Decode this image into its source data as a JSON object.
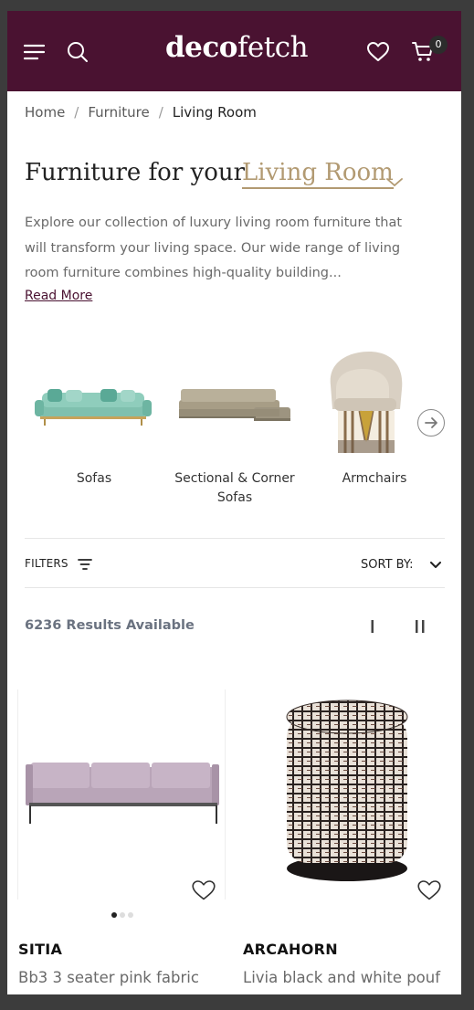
{
  "header": {
    "logo_bold": "deco",
    "logo_regular": "fetch",
    "cart_count": "0",
    "menu_icon": "hamburger-menu-icon",
    "search_icon": "search-icon",
    "wishlist_icon": "heart-icon",
    "cart_icon": "cart-icon",
    "bg_color": "#4a1231"
  },
  "breadcrumb": {
    "items": [
      "Home",
      "Furniture",
      "Living Room"
    ],
    "separator": "/"
  },
  "page": {
    "title_prefix": "Furniture for your",
    "title_selected": "Living Room",
    "accent_color": "#b29a72",
    "description": "Explore our collection of luxury living room furniture that will transform your living space. Our wide range of living room furniture combines high-quality building...",
    "read_more": "Read More"
  },
  "categories": [
    {
      "label": "Sofas"
    },
    {
      "label": "Sectional & Corner Sofas"
    },
    {
      "label": "Armchairs"
    }
  ],
  "toolbar": {
    "filters_label": "FILTERS",
    "sort_label": "SORT BY:",
    "results_text": "6236 Results Available"
  },
  "products": [
    {
      "brand": "SITIA",
      "name": "Bb3 3 seater pink fabric",
      "carousel_dots": 3,
      "active_dot": 1
    },
    {
      "brand": "ARCAHORN",
      "name": "Livia black and white pouf"
    }
  ]
}
